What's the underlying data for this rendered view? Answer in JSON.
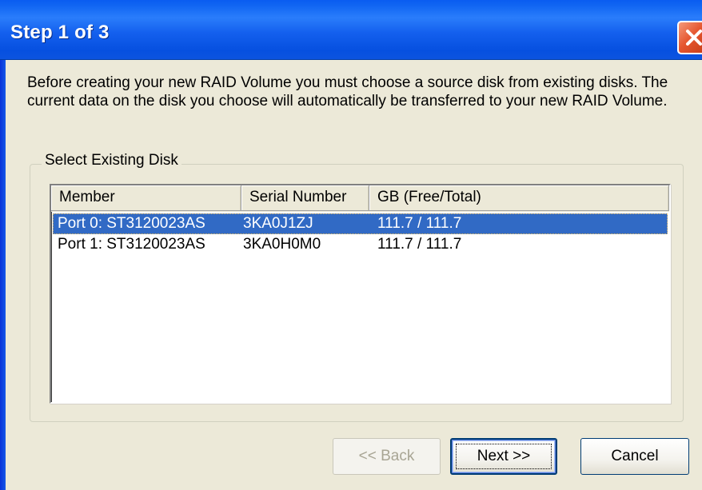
{
  "window": {
    "title": "Step 1 of 3"
  },
  "description": "Before creating your new RAID Volume you must choose a source disk from existing disks. The current data on the disk you choose will automatically be transferred to your new RAID Volume.",
  "group": {
    "label": "Select Existing Disk"
  },
  "listview": {
    "columns": {
      "member": "Member",
      "serial": "Serial Number",
      "gb": "GB (Free/Total)"
    },
    "rows": [
      {
        "member": "Port 0: ST3120023AS",
        "serial": "3KA0J1ZJ",
        "gb": "111.7 / 111.7",
        "selected": true
      },
      {
        "member": "Port 1: ST3120023AS",
        "serial": "3KA0H0M0",
        "gb": "111.7 / 111.7",
        "selected": false
      }
    ]
  },
  "buttons": {
    "back": "<< Back",
    "next": "Next >>",
    "cancel": "Cancel"
  },
  "colors": {
    "titlebar": "#0A5CF1",
    "selection": "#316AC5",
    "dialog_bg": "#ECE9D8",
    "close_button": "#E5552F"
  },
  "icons": {
    "close": "close-icon"
  }
}
